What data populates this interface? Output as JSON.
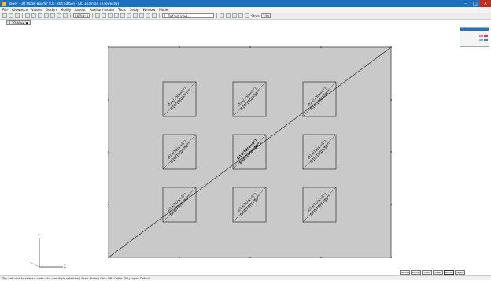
{
  "window": {
    "title": "Tower - 3D Model Builder 8.0 - x64 Edition - [3D Example T8.tower.tw]",
    "minimize_glyph": "–",
    "maximize_glyph": "□",
    "close_glyph": "×"
  },
  "menu": [
    "File",
    "Allowance",
    "Values",
    "Design",
    "Modify",
    "Layout",
    "Auxiliary model",
    "Tools",
    "Setup",
    "Window",
    "Mode"
  ],
  "toolbar": {
    "layer_combo": "RADIALA",
    "view_combo": "1. Default load",
    "zoom_label": "Store",
    "zoom_value": "100"
  },
  "view_tab": {
    "label": "1 3D View ▼"
  },
  "drawing": {
    "grid_rows": 3,
    "grid_cols": 3,
    "element_label_top": "Ø14/10(α=0°)",
    "element_label_bottom": "Ø10/14(α=90°)",
    "axis_x_label": "X",
    "axis_y_label": "Y"
  },
  "bottom_tabs": [
    "3D View",
    "Isometric",
    "Plan",
    "Views",
    "Sections",
    "Layers"
  ],
  "status_text": "Tip: Left click to select a node.  Ctrl = multiple selection  |  Snap: Node  |  Grid: Off  |  Ortho: Off  |  Layer: Default"
}
